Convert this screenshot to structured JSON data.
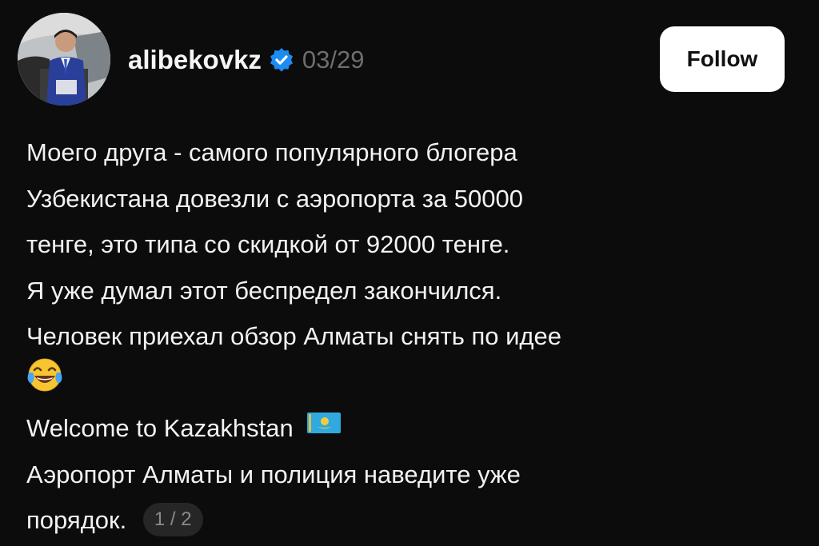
{
  "post": {
    "author": {
      "username": "alibekovkz",
      "verified_icon": "verified-badge-icon",
      "date": "03/29"
    },
    "follow_label": "Follow",
    "lines": [
      "Моего друга - самого популярного блогера",
      "Узбекистана довезли с аэропорта за 50000",
      "тенге, это типа со скидкой от 92000 тенге.",
      "Я уже думал этот беспредел закончился.",
      "Человек приехал обзор Алматы снять по идее",
      "",
      "Welcome to Kazakhstan",
      "Аэропорт Алматы и полиция наведите уже",
      "порядок."
    ],
    "emoji_icon": "face-with-tears-of-joy-icon",
    "flag_icon": "kazakhstan-flag-icon",
    "page_indicator": "1 / 2"
  },
  "colors": {
    "background": "#0c0c0c",
    "text": "#f2f2f2",
    "date": "#6e6e6e",
    "verified": "#1d8cf0",
    "follow_bg": "#ffffff"
  }
}
